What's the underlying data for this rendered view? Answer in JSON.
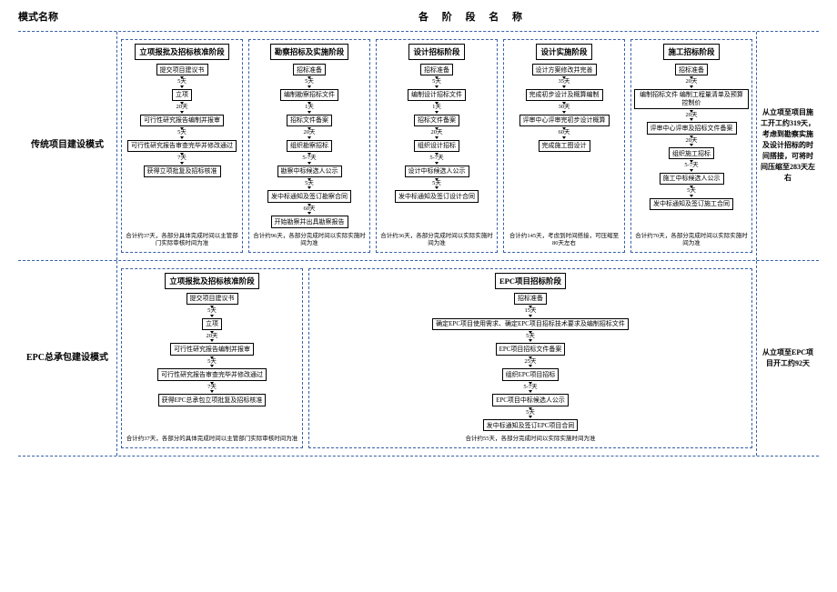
{
  "headers": {
    "left": "模式名称",
    "right": "各 阶 段 名 称"
  },
  "row1": {
    "label": "传统项目建设模式",
    "note": "从立项至项目施工开工约319天，考虑到勘察实施及设计招标的时间搭接，可将时间压缩至283天左右",
    "stages": [
      {
        "title": "立项报批及招标核准阶段",
        "steps": [
          {
            "box": "提交项目建议书"
          },
          {
            "dur": "5天"
          },
          {
            "box": "立项"
          },
          {
            "dur": "20天"
          },
          {
            "box": "可行性研究报告编制并报审"
          },
          {
            "dur": "5天"
          },
          {
            "box": "可行性研究报告审查完毕并修改通过"
          },
          {
            "dur": "7天"
          },
          {
            "box": "获得立项批复及招标核准"
          }
        ],
        "summary": "合计约37天，各部分具体完成时间以主管部门实际审核时间为准"
      },
      {
        "title": "勘察招标及实施阶段",
        "steps": [
          {
            "box": "招标准备"
          },
          {
            "dur": "5天"
          },
          {
            "box": "编制勘察招标文件"
          },
          {
            "dur": "1天"
          },
          {
            "box": "招标文件备案"
          },
          {
            "dur": "20天"
          },
          {
            "box": "组织勘察招标"
          },
          {
            "dur": "5-7天"
          },
          {
            "box": "勘察中标候选人公示"
          },
          {
            "dur": "5天"
          },
          {
            "box": "发中标通知及签订勘察合同"
          },
          {
            "dur": "60天"
          },
          {
            "box": "开始勘察并出具勘察报告"
          }
        ],
        "summary": "合计约96天，各部分完成时间以实际实施时间为准"
      },
      {
        "title": "设计招标阶段",
        "steps": [
          {
            "box": "招标准备"
          },
          {
            "dur": "5天"
          },
          {
            "box": "编制设计招标文件"
          },
          {
            "dur": "1天"
          },
          {
            "box": "招标文件备案"
          },
          {
            "dur": "20天"
          },
          {
            "box": "组织设计招标"
          },
          {
            "dur": "5-7天"
          },
          {
            "box": "设计中标候选人公示"
          },
          {
            "dur": "5天"
          },
          {
            "box": "发中标通知及签订设计合同"
          }
        ],
        "summary": "合计约36天，各部分完成时间以实际实施时间为准"
      },
      {
        "title": "设计实施阶段",
        "steps": [
          {
            "box": "设计方案修改并完善"
          },
          {
            "dur": "35天"
          },
          {
            "box": "完成初步设计及概算编制"
          },
          {
            "dur": "30天"
          },
          {
            "box": "评审中心评审完初步设计概算"
          },
          {
            "dur": "60天"
          },
          {
            "box": "完成施工图设计"
          }
        ],
        "summary": "合计约145天，考虑到时间搭接，可压缩至80天左右"
      },
      {
        "title": "施工招标阶段",
        "steps": [
          {
            "box": "招标准备"
          },
          {
            "dur": "20天"
          },
          {
            "box": "编制招标文件\n编制工程量清单及预算控制价"
          },
          {
            "dur": "20天"
          },
          {
            "box": "评审中心评审及招标文件备案"
          },
          {
            "dur": "20天"
          },
          {
            "box": "组织施工招标"
          },
          {
            "dur": "5-7天"
          },
          {
            "box": "施工中标候选人公示"
          },
          {
            "dur": "5天"
          },
          {
            "box": "发中标通知及签订施工合同"
          }
        ],
        "summary": "合计约70天，各部分完成时间以实际实施时间为准"
      }
    ]
  },
  "row2": {
    "label": "EPC总承包建设模式",
    "note": "从立项至EPC项目开工约92天",
    "stages": [
      {
        "title": "立项报批及招标核准阶段",
        "steps": [
          {
            "box": "提交项目建议书"
          },
          {
            "dur": "5天"
          },
          {
            "box": "立项"
          },
          {
            "dur": "20天"
          },
          {
            "box": "可行性研究报告编制并报审"
          },
          {
            "dur": "5天"
          },
          {
            "box": "可行性研究报告审查完毕并修改通过"
          },
          {
            "dur": "7天"
          },
          {
            "box": "获得EPC总承包立项批复及招标核准"
          }
        ],
        "summary": "合计约37天，各部分的具体完成时间以主管部门实际审核时间为准"
      },
      {
        "title": "EPC项目招标阶段",
        "wide": true,
        "steps": [
          {
            "box": "招标准备"
          },
          {
            "dur": "15天"
          },
          {
            "box": "确定EPC项目使用需求、确定EPC项目招标技术要求及编制招标文件"
          },
          {
            "dur": "5天"
          },
          {
            "box": "EPC项目招标文件备案"
          },
          {
            "dur": "25天"
          },
          {
            "box": "组织EPC项目招标"
          },
          {
            "dur": "5-7天"
          },
          {
            "box": "EPC项目中标候选人公示"
          },
          {
            "dur": "5天"
          },
          {
            "box": "发中标通知及签订EPC项目合同"
          }
        ],
        "summary": "合计约55天，各部分完成时间以实际实施时间为准"
      }
    ]
  }
}
